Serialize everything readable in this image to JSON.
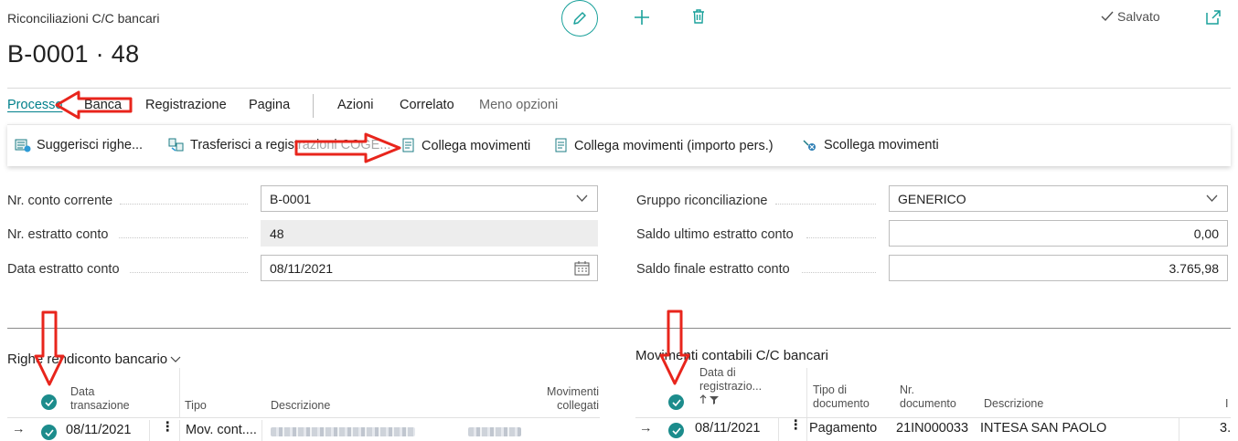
{
  "header": {
    "caption": "Riconciliazioni C/C bancari",
    "title": "B-0001 · 48",
    "saved_label": "Salvato"
  },
  "tabs": [
    {
      "label": "Processo",
      "active": true
    },
    {
      "label": "Banca"
    },
    {
      "label": "Registrazione"
    },
    {
      "label": "Pagina"
    },
    {
      "label": "Azioni"
    },
    {
      "label": "Correlato"
    },
    {
      "label": "Meno opzioni"
    }
  ],
  "actions": {
    "suggest": "Suggerisci righe...",
    "transfer": "Trasferisci a registrazioni COGE...",
    "match": "Collega movimenti",
    "match_manual": "Collega movimenti (importo pers.)",
    "unmatch": "Scollega movimenti"
  },
  "fields_left": [
    {
      "label": "Nr. conto corrente",
      "value": "B-0001"
    },
    {
      "label": "Nr. estratto conto",
      "value": "48"
    },
    {
      "label": "Data estratto conto",
      "value": "08/11/2021"
    }
  ],
  "fields_right": [
    {
      "label": "Gruppo riconciliazione",
      "value": "GENERICO"
    },
    {
      "label": "Saldo ultimo estratto conto",
      "value": "0,00"
    },
    {
      "label": "Saldo finale estratto conto",
      "value": "3.765,98"
    }
  ],
  "left_part": {
    "title": "Righe rendiconto bancario",
    "columns": {
      "date_1": "Data",
      "date_2": "transazione",
      "type": "Tipo",
      "description": "Descrizione",
      "applied_1": "Movimenti",
      "applied_2": "collegati"
    },
    "row": {
      "date": "08/11/2021",
      "type": "Mov. cont...."
    }
  },
  "right_part": {
    "title": "Movimenti contabili C/C bancari",
    "columns": {
      "posting_1": "Data di",
      "posting_2": "registrazio...",
      "doc_type_1": "Tipo di",
      "doc_type_2": "documento",
      "doc_no_1": "Nr.",
      "doc_no_2": "documento",
      "description": "Descrizione",
      "amount": "I"
    },
    "row": {
      "date": "08/11/2021",
      "doc_type": "Pagamento",
      "doc_no": "21IN000033",
      "description": "INTESA SAN PAOLO",
      "amount": "3."
    }
  },
  "colors": {
    "accent": "#00808b",
    "check": "#1c8c8c",
    "annotation_arrow": "#e8251c"
  }
}
